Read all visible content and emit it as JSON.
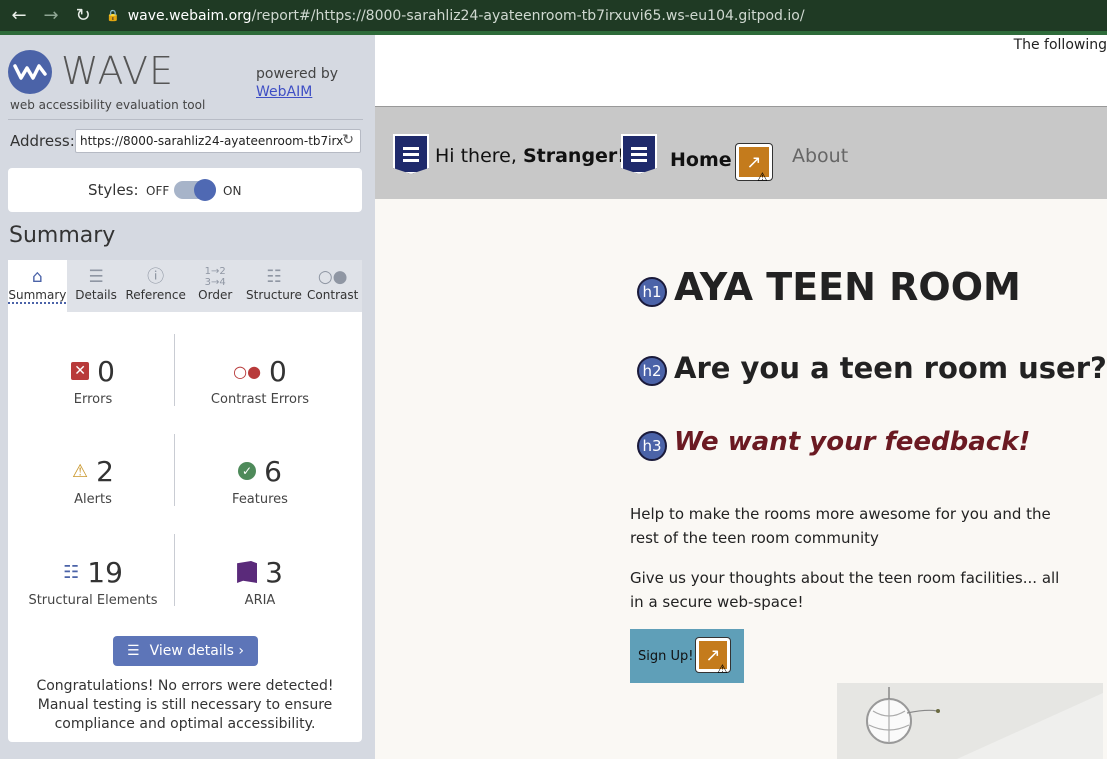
{
  "browser": {
    "url_host": "wave.webaim.org",
    "url_rest": "/report#/https://8000-sarahliz24-ayateenroom-tb7irxuvi65.ws-eu104.gitpod.io/"
  },
  "wave": {
    "title": "WAVE",
    "subtitle": "web accessibility evaluation tool",
    "powered_by": "powered by",
    "webaim_link": "WebAIM",
    "address_label": "Address:",
    "address_value": "https://8000-sarahliz24-ayateenroom-tb7irx",
    "styles_label": "Styles:",
    "styles_off": "OFF",
    "styles_on": "ON",
    "summary_heading": "Summary",
    "tabs": [
      {
        "label": "Summary",
        "icon": "home-icon"
      },
      {
        "label": "Details",
        "icon": "list-icon"
      },
      {
        "label": "Reference",
        "icon": "info-icon"
      },
      {
        "label": "Order",
        "icon": "order-icon"
      },
      {
        "label": "Structure",
        "icon": "structure-icon"
      },
      {
        "label": "Contrast",
        "icon": "contrast-icon"
      }
    ],
    "stats": {
      "errors": {
        "value": "0",
        "label": "Errors"
      },
      "contrast_errors": {
        "value": "0",
        "label": "Contrast Errors"
      },
      "alerts": {
        "value": "2",
        "label": "Alerts"
      },
      "features": {
        "value": "6",
        "label": "Features"
      },
      "structural": {
        "value": "19",
        "label": "Structural Elements"
      },
      "aria": {
        "value": "3",
        "label": "ARIA"
      }
    },
    "view_details": "View details ›",
    "congrats": "Congratulations! No errors were detected! Manual testing is still necessary to ensure compliance and optimal accessibility."
  },
  "site": {
    "following_text": "The following",
    "hi_text_prefix": "Hi there, ",
    "hi_text_name": "Stranger!",
    "home_link": "Home",
    "about_link": "About",
    "h1_badge": "h1",
    "h1": "AYA TEEN ROOM",
    "h2_badge": "h2",
    "h2": "Are you a teen room user?",
    "h3_badge": "h3",
    "h3": "We want your feedback!",
    "para1": "Help to make the rooms more awesome for you and the rest of the teen room community",
    "para2": "Give us your thoughts about the teen room facilities... all in a secure web-space!",
    "signup": "Sign Up!"
  },
  "colors": {
    "wave_blue": "#4b63a8",
    "error_red": "#b83a3a",
    "alert_amber": "#c9962a",
    "feature_green": "#4e8a5a",
    "aria_purple": "#5a2a7a",
    "h3_color": "#6b1a22",
    "signup_bg": "#5f9fb8"
  }
}
